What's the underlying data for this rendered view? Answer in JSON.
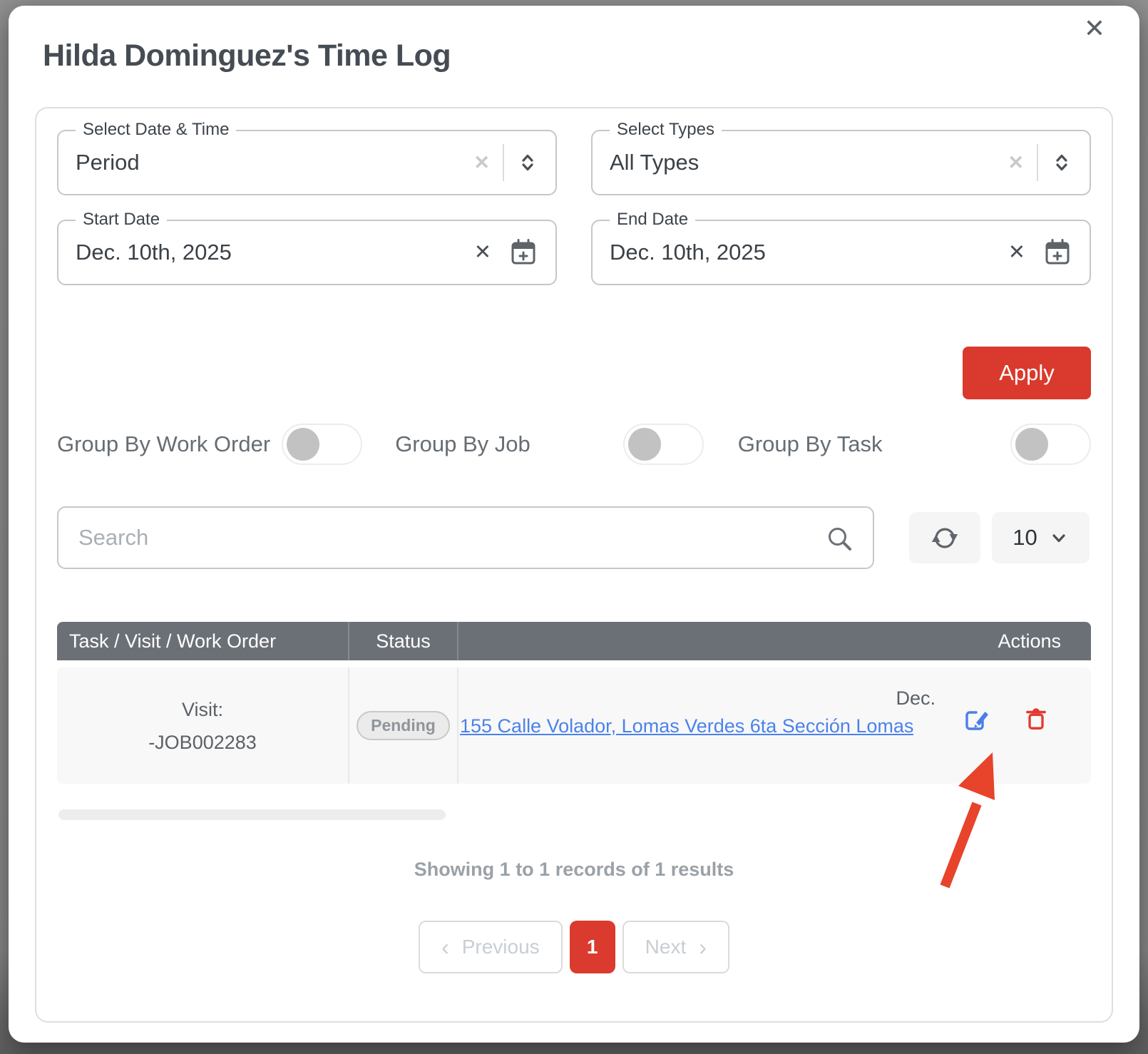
{
  "modal": {
    "title": "Hilda Dominguez's Time Log"
  },
  "icons": {
    "close": "✕",
    "clear": "✕",
    "chevron_left": "‹",
    "chevron_right": "›"
  },
  "filters": {
    "date_time": {
      "label": "Select Date & Time",
      "value": "Period"
    },
    "types": {
      "label": "Select Types",
      "value": "All Types"
    },
    "start_date": {
      "label": "Start Date",
      "value": "Dec. 10th, 2025"
    },
    "end_date": {
      "label": "End Date",
      "value": "Dec. 10th, 2025"
    },
    "apply_label": "Apply"
  },
  "toggles": [
    {
      "label": "Group By Work Order",
      "on": false
    },
    {
      "label": "Group By Job",
      "on": false
    },
    {
      "label": "Group By Task",
      "on": false
    }
  ],
  "toolbar": {
    "search_placeholder": "Search",
    "page_size": "10"
  },
  "table": {
    "headers": [
      "Task / Visit / Work Order",
      "Status",
      "",
      "Actions"
    ],
    "rows": [
      {
        "task_line1": "Visit:",
        "task_line2": "-JOB002283",
        "status": "Pending",
        "date_text": "Dec.",
        "link_text": "155 Calle Volador, Lomas Verdes 6ta Sección Lomas"
      }
    ]
  },
  "footer": {
    "summary": "Showing 1 to 1 records of 1 results",
    "previous_label": "Previous",
    "current_page": "1",
    "next_label": "Next"
  },
  "colors": {
    "accent_red": "#d93a2d",
    "link_blue": "#4b82ea",
    "edit_blue": "#4b7fe8",
    "trash_red": "#e23b2e",
    "header_gray": "#6b7076",
    "arrow_red": "#e8432b"
  }
}
